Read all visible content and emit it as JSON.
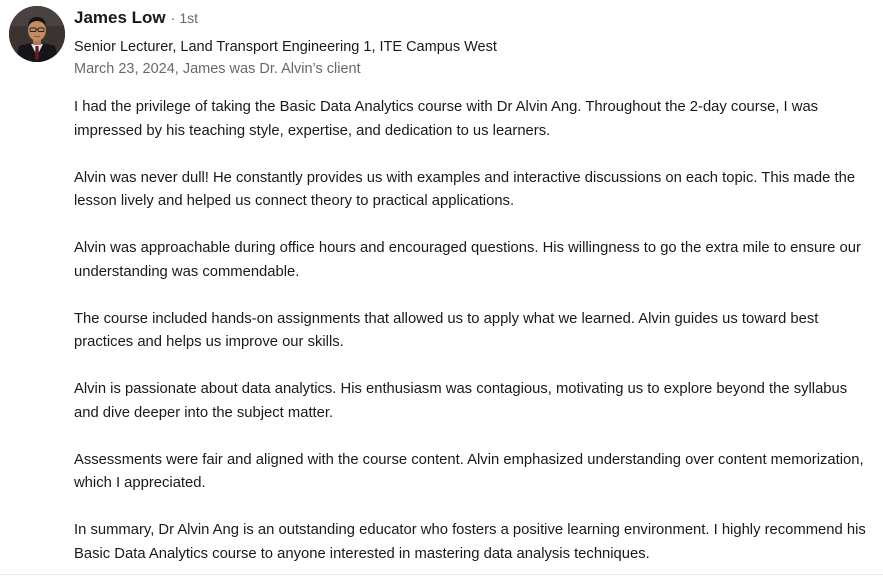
{
  "recommendation": {
    "author": {
      "name": "James Low",
      "degree_separator": "·",
      "degree": "1st",
      "headline": "Senior Lecturer, Land Transport Engineering 1, ITE Campus West",
      "relationship": "March 23, 2024, James was Dr. Alvin’s client"
    },
    "paragraphs": [
      "I had the privilege of taking the Basic Data Analytics course with Dr Alvin Ang. Throughout the 2-day course, I was impressed by his teaching style, expertise, and dedication to us learners.",
      "Alvin was never dull! He constantly provides us with examples and interactive discussions on each topic. This made the lesson lively and helped us connect theory to practical applications.",
      "Alvin was approachable during office hours and encouraged questions. His willingness to go the extra mile to ensure our understanding was commendable.",
      "The course included hands-on assignments that allowed us to apply what we learned. Alvin guides us toward best practices and helps us improve our skills.",
      "Alvin is passionate about data analytics. His enthusiasm was contagious, motivating us to explore beyond the syllabus and dive deeper into the subject matter.",
      "Assessments were fair and aligned with the course content. Alvin emphasized understanding over content memorization, which I appreciated.",
      "In summary, Dr Alvin Ang is an outstanding educator who fosters a positive learning environment. I highly recommend his Basic Data Analytics course to anyone interested in mastering data analysis techniques."
    ]
  },
  "colors": {
    "text_primary": "#1a1a1a",
    "text_secondary": "#666666",
    "background": "#ffffff",
    "divider": "#e8e8e8"
  }
}
